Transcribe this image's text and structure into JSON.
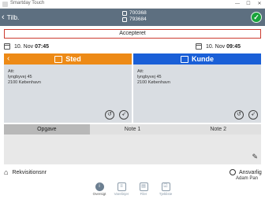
{
  "window": {
    "app_title": "Smartday Touch",
    "min_glyph": "—",
    "max_glyph": "☐",
    "close_glyph": "✕"
  },
  "topbar": {
    "back_glyph": "‹",
    "back_label": "Tilb.",
    "id_1": "700368",
    "id_2": "793684",
    "confirm_glyph": "✓",
    "bg_color": "#5d6f80",
    "confirm_color": "#1aa33b"
  },
  "status": {
    "label": "Accepteret",
    "border_color": "#cc3b2f"
  },
  "start": {
    "date": "10. Nov",
    "time": "07:45"
  },
  "end": {
    "date": "10. Nov",
    "time": "09:45"
  },
  "sted": {
    "back_glyph": "‹",
    "title": "Sted",
    "att": "Att:",
    "street": "lyngbyvej 45",
    "city": "2100 København",
    "color": "#ed8a16",
    "history_glyph": "↺",
    "navigate_glyph": "➶"
  },
  "kunde": {
    "title": "Kunde",
    "att": "Att:",
    "street": "lyngbyvej 45",
    "city": "2100 København",
    "color": "#1a5fd7",
    "history_glyph": "↺",
    "navigate_glyph": "➶"
  },
  "tabs": [
    "Opgave",
    "Note 1",
    "Note 2"
  ],
  "notes": {
    "edit_glyph": "✎"
  },
  "rekvisition": {
    "tag_glyph": "⌂",
    "label": "Rekvisitionsnr"
  },
  "ansvarlig": {
    "label": "Ansvarlig",
    "name": "Adam Pan"
  },
  "bottom_nav": [
    {
      "glyph": "i",
      "label": "Oversigt",
      "icon": "info-icon"
    },
    {
      "glyph": "≡",
      "label": "Varelinjer",
      "icon": "list-icon"
    },
    {
      "glyph": "▤",
      "label": "Filer",
      "icon": "files-icon"
    },
    {
      "glyph": "☑",
      "label": "Tjekliste",
      "icon": "checklist-icon"
    }
  ]
}
